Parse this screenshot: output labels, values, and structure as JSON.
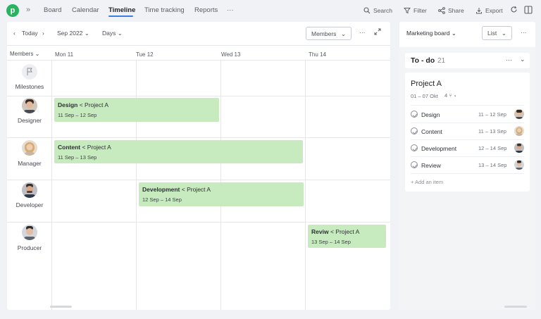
{
  "nav": {
    "logo_letter": "p",
    "tabs": [
      {
        "label": "Board"
      },
      {
        "label": "Calendar"
      },
      {
        "label": "Timeline"
      },
      {
        "label": "Time tracking"
      },
      {
        "label": "Reports"
      }
    ],
    "more": "···",
    "tools": {
      "search": "Search",
      "filter": "Filter",
      "share": "Share",
      "export": "Export"
    }
  },
  "toolbar": {
    "today": "Today",
    "month": "Sep 2022",
    "scale": "Days",
    "members": "Members",
    "more": "···"
  },
  "timeline": {
    "members_header": "Members",
    "days": [
      "Mon 11",
      "Tue 12",
      "Wed 13",
      "Thu 14"
    ],
    "rows": [
      {
        "label": "Milestones"
      },
      {
        "label": "Designer"
      },
      {
        "label": "Manager"
      },
      {
        "label": "Developer"
      },
      {
        "label": "Producer"
      }
    ],
    "bars": [
      {
        "task": "Design",
        "project": "< Project A",
        "dates": "11 Sep – 12 Sep"
      },
      {
        "task": "Content",
        "project": "< Project A",
        "dates": "11 Sep – 13 Sep"
      },
      {
        "task": "Development",
        "project": "< Project A",
        "dates": "12 Sep – 14 Sep"
      },
      {
        "task": "Reviw",
        "project": "< Project A",
        "dates": "13 Sep – 14 Sep"
      }
    ]
  },
  "side": {
    "board": "Marketing board",
    "view": "List",
    "more": "···",
    "column": {
      "title": "To - do",
      "count": "21",
      "more": "···"
    },
    "card": {
      "title": "Project A",
      "dates": "01 – 07 Okt",
      "subtasks": "4",
      "tasks": [
        {
          "name": "Design",
          "date": "11 – 12 Sep"
        },
        {
          "name": "Content",
          "date": "11 – 13 Sep"
        },
        {
          "name": "Development",
          "date": "12 – 14 Sep"
        },
        {
          "name": "Review",
          "date": "13 – 14 Sep"
        }
      ],
      "add_item": "+ Add an item"
    }
  },
  "colors": {
    "accent": "#3b7fe6",
    "brand": "#27b35f",
    "bar": "#c8eabf"
  }
}
